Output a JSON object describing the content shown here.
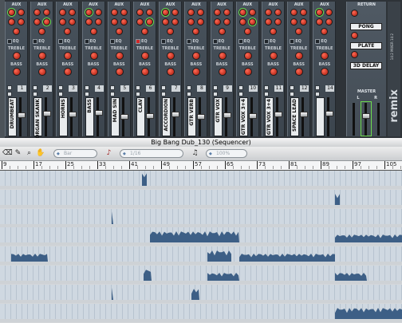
{
  "mixer": {
    "aux_label": "AUX",
    "eq_label": "EQ",
    "treble_label": "TREBLE",
    "bass_label": "BASS",
    "mute_label": "M",
    "solo_label": "S",
    "aux_numbers": [
      "1",
      "2",
      "3",
      "4"
    ],
    "channels": [
      {
        "number": "1",
        "name": "DRUMBEAT",
        "fader": 0.55
      },
      {
        "number": "2",
        "name": "ORGAN SKANK",
        "fader": 0.6
      },
      {
        "number": "3",
        "name": "HORNS",
        "fader": 0.58
      },
      {
        "number": "4",
        "name": "BASS",
        "fader": 0.62
      },
      {
        "number": "5",
        "name": "MAD SIN",
        "fader": 0.5
      },
      {
        "number": "6",
        "name": "CLAV",
        "fader": 0.52
      },
      {
        "number": "7",
        "name": "ACCORDION",
        "fader": 0.56
      },
      {
        "number": "8",
        "name": "GTR VERB",
        "fader": 0.5
      },
      {
        "number": "9",
        "name": "GTR VOX",
        "fader": 0.54
      },
      {
        "number": "10",
        "name": "GTR VOX 3+4",
        "fader": 0.52
      },
      {
        "number": "11",
        "name": "GTR VOX 3+4",
        "fader": 0.56
      },
      {
        "number": "12",
        "name": "SPACE LEAD",
        "fader": 0.58
      },
      {
        "number": "14",
        "name": "",
        "fader": 0.6
      }
    ],
    "returns": {
      "title": "RETURN",
      "items": [
        "PONG",
        "PLATE",
        "3D DELAY"
      ],
      "master_label": "MASTER",
      "lr": [
        "L",
        "R"
      ]
    },
    "brand": "remix",
    "brand_sub": "14:2 MIXER 14:2"
  },
  "sequencer": {
    "title": "Big Bang Dub_130 (Sequencer)",
    "snap_value": "Bar",
    "quantize_value": "1/16",
    "zoom_value": "100%",
    "ruler": [
      "9",
      "17",
      "25",
      "33",
      "41",
      "49",
      "57",
      "65",
      "73",
      "81",
      "89",
      "97",
      "105"
    ],
    "lanes": 8
  },
  "colors": {
    "accent_knob": "#d02818",
    "lane_bg": "#cfd8e1",
    "lane_fill": "#3d5f86",
    "panel": "#48525c"
  }
}
